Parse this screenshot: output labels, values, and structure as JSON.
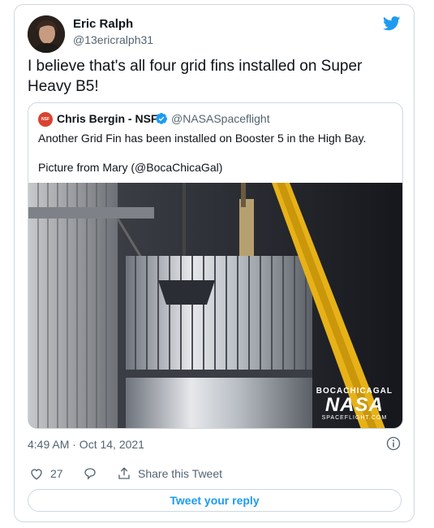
{
  "tweet": {
    "author_name": "Eric Ralph",
    "author_handle": "@13ericralph31",
    "text": "I believe that's all four grid fins installed on Super Heavy B5!",
    "timestamp": "4:49 AM · Oct 14, 2021",
    "like_count": "27",
    "share_label": "Share this Tweet",
    "reply_label": "Tweet your reply"
  },
  "quoted": {
    "avatar_text": "NSF",
    "author_name": "Chris Bergin - NSF",
    "author_handle": "@NASASpaceflight",
    "text_line1": "Another Grid Fin has been installed on Booster 5 in the High Bay.",
    "text_line2": "Picture from Mary (@BocaChicaGal)",
    "watermark_top": "BOCACHICAGAL",
    "watermark_main": "NASA",
    "watermark_sub": "SPACEFLIGHT.COM"
  },
  "colors": {
    "accent": "#1d9bf0",
    "text": "#0f1419",
    "muted": "#536471",
    "border": "#cfd9de"
  },
  "icons": [
    "twitter-bird-icon",
    "verified-badge-icon",
    "info-icon",
    "heart-icon",
    "reply-icon",
    "share-icon"
  ]
}
